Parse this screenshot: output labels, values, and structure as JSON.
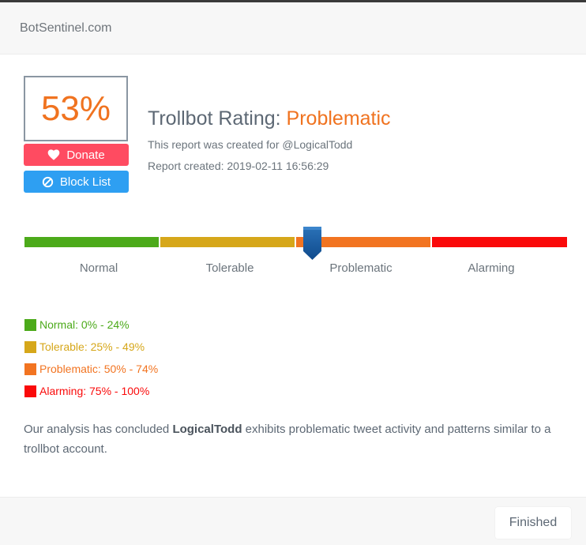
{
  "header": {
    "site_name": "BotSentinel.com"
  },
  "score": {
    "value": "53%",
    "percent": 53
  },
  "buttons": {
    "donate_label": "Donate",
    "blocklist_label": "Block List"
  },
  "rating": {
    "title_prefix": "Trollbot Rating:",
    "value": "Problematic",
    "report_for": "This report was created for @LogicalTodd",
    "report_created": "Report created: 2019-02-11 16:56:29"
  },
  "meter": {
    "labels": [
      "Normal",
      "Tolerable",
      "Problematic",
      "Alarming"
    ],
    "colors": [
      "#4caa1a",
      "#d6a71a",
      "#f27421",
      "#fa0a0a"
    ],
    "marker_fraction": 0.53
  },
  "legend": [
    {
      "text": "Normal: 0% - 24%",
      "color": "#4caa1a"
    },
    {
      "text": "Tolerable: 25% - 49%",
      "color": "#d6a71a"
    },
    {
      "text": "Problematic: 50% - 74%",
      "color": "#f27421"
    },
    {
      "text": "Alarming: 75% - 100%",
      "color": "#fa0a0a"
    }
  ],
  "summary": {
    "before": "Our analysis has concluded ",
    "handle": "LogicalTodd",
    "after": " exhibits problematic tweet activity and patterns similar to a trollbot account."
  },
  "footer": {
    "finished_label": "Finished"
  },
  "icons": {
    "donate": "heart-icon",
    "blocklist": "ban-icon"
  }
}
